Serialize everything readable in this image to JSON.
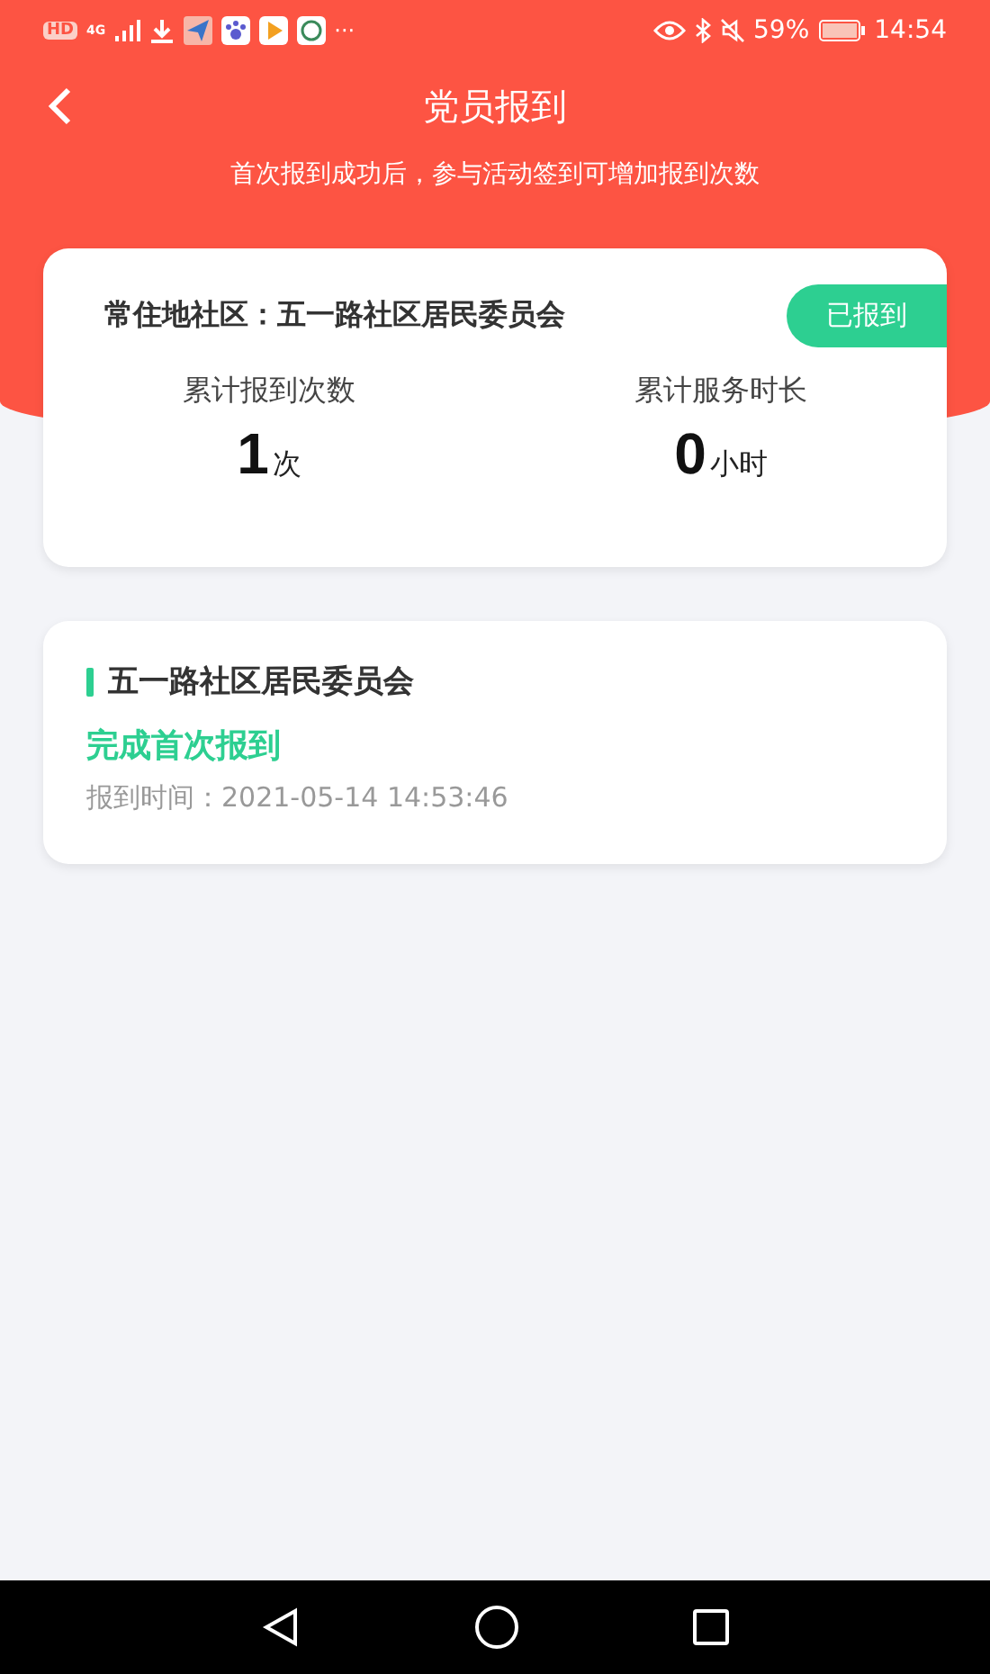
{
  "status_bar": {
    "left_badge": "HD",
    "network": "4G",
    "more": "···",
    "battery": "59%",
    "time": "14:54"
  },
  "header": {
    "title": "党员报到",
    "subtitle": "首次报到成功后，参与活动签到可增加报到次数"
  },
  "summary": {
    "community_label": "常住地社区：五一路社区居民委员会",
    "badge": "已报到",
    "stats": [
      {
        "label": "累计报到次数",
        "value": "1",
        "unit": "次"
      },
      {
        "label": "累计服务时长",
        "value": "0",
        "unit": "小时"
      }
    ]
  },
  "records": [
    {
      "community": "五一路社区居民委员会",
      "status": "完成首次报到",
      "time": "报到时间：2021-05-14 14:53:46"
    }
  ]
}
